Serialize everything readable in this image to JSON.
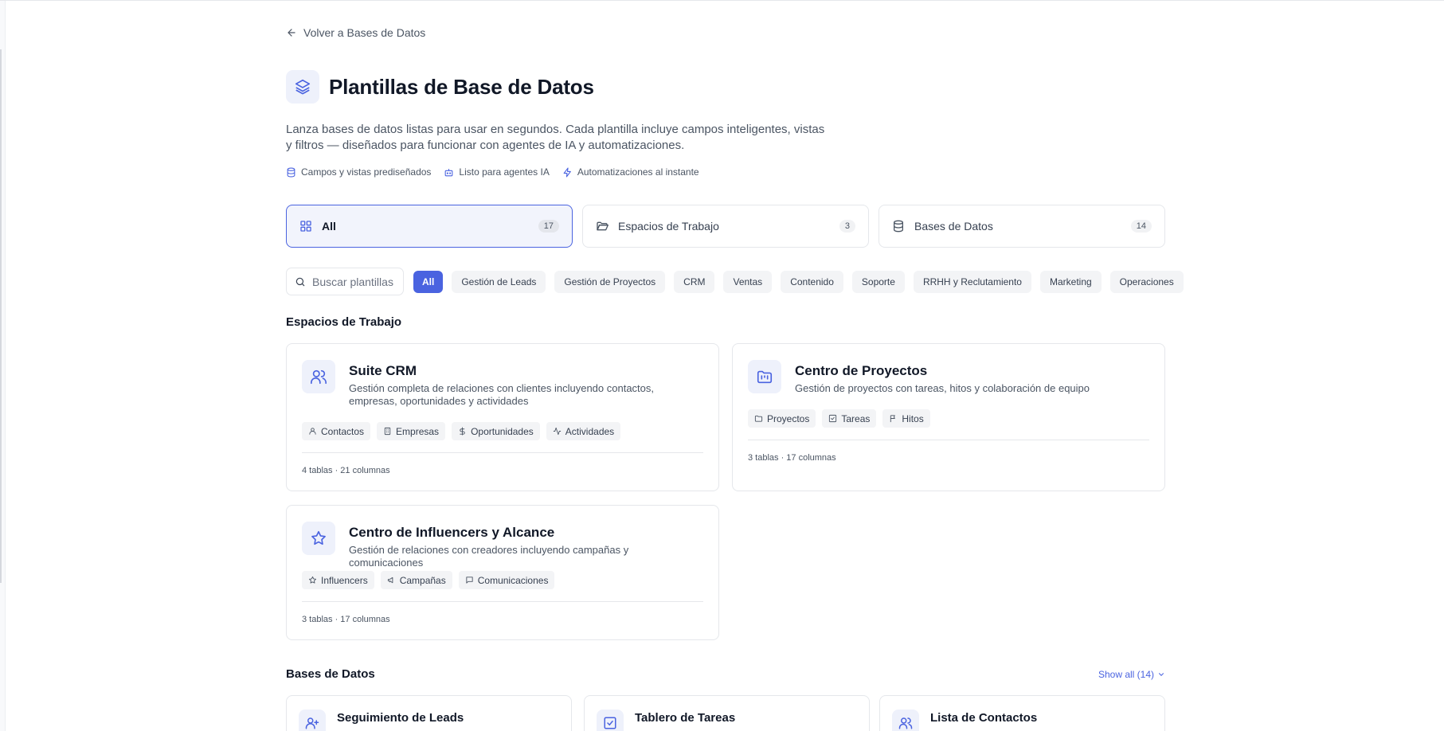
{
  "nav": {
    "back_label": "Volver a Bases de Datos"
  },
  "header": {
    "title": "Plantillas de Base de Datos",
    "description": "Lanza bases de datos listas para usar en segundos. Cada plantilla incluye campos inteligentes, vistas y filtros — diseñados para funcionar con agentes de IA y automatizaciones.",
    "features": [
      {
        "label": "Campos y vistas prediseñados",
        "icon": "database-icon"
      },
      {
        "label": "Listo para agentes IA",
        "icon": "bot-icon"
      },
      {
        "label": "Automatizaciones al instante",
        "icon": "lightning-icon"
      }
    ]
  },
  "type_tabs": [
    {
      "label": "All",
      "count": "17",
      "icon": "grid-icon",
      "active": true
    },
    {
      "label": "Espacios de Trabajo",
      "count": "3",
      "icon": "folder-open-icon"
    },
    {
      "label": "Bases de Datos",
      "count": "14",
      "icon": "database-icon"
    }
  ],
  "search": {
    "placeholder": "Buscar plantillas"
  },
  "categories": [
    "All",
    "Gestión de Leads",
    "Gestión de Proyectos",
    "CRM",
    "Ventas",
    "Contenido",
    "Soporte",
    "RRHH y Reclutamiento",
    "Marketing",
    "Operaciones"
  ],
  "workspaces": {
    "title": "Espacios de Trabajo",
    "cards": [
      {
        "title": "Suite CRM",
        "description": "Gestión completa de relaciones con clientes incluyendo contactos, empresas, oportunidades y actividades",
        "icon": "users-icon",
        "tags": [
          {
            "label": "Contactos",
            "icon": "user-icon"
          },
          {
            "label": "Empresas",
            "icon": "building-icon"
          },
          {
            "label": "Oportunidades",
            "icon": "dollar-icon"
          },
          {
            "label": "Actividades",
            "icon": "activity-icon"
          }
        ],
        "meta": "4 tablas · 21 columnas"
      },
      {
        "title": "Centro de Proyectos",
        "description": "Gestión de proyectos con tareas, hitos y colaboración de equipo",
        "icon": "folder-kanban-icon",
        "tags": [
          {
            "label": "Proyectos",
            "icon": "folder-icon"
          },
          {
            "label": "Tareas",
            "icon": "checkbox-icon"
          },
          {
            "label": "Hitos",
            "icon": "flag-icon"
          }
        ],
        "meta": "3 tablas · 17 columnas"
      },
      {
        "title": "Centro de Influencers y Alcance",
        "description": "Gestión de relaciones con creadores incluyendo campañas y comunicaciones",
        "icon": "star-icon",
        "tags": [
          {
            "label": "Influencers",
            "icon": "star-icon"
          },
          {
            "label": "Campañas",
            "icon": "megaphone-icon"
          },
          {
            "label": "Comunicaciones",
            "icon": "message-icon"
          }
        ],
        "meta": "3 tablas · 17 columnas"
      }
    ]
  },
  "databases": {
    "title": "Bases de Datos",
    "show_all": "Show all (14)",
    "cards": [
      {
        "title": "Seguimiento de Leads",
        "icon": "user-plus-icon"
      },
      {
        "title": "Tablero de Tareas",
        "icon": "checkbox-icon"
      },
      {
        "title": "Lista de Contactos",
        "icon": "users-icon"
      }
    ]
  },
  "colors": {
    "accent": "#4a63e0",
    "icon_bg": "#eef1fb",
    "border": "#e5e7eb",
    "chip_bg": "#f3f4f6"
  }
}
